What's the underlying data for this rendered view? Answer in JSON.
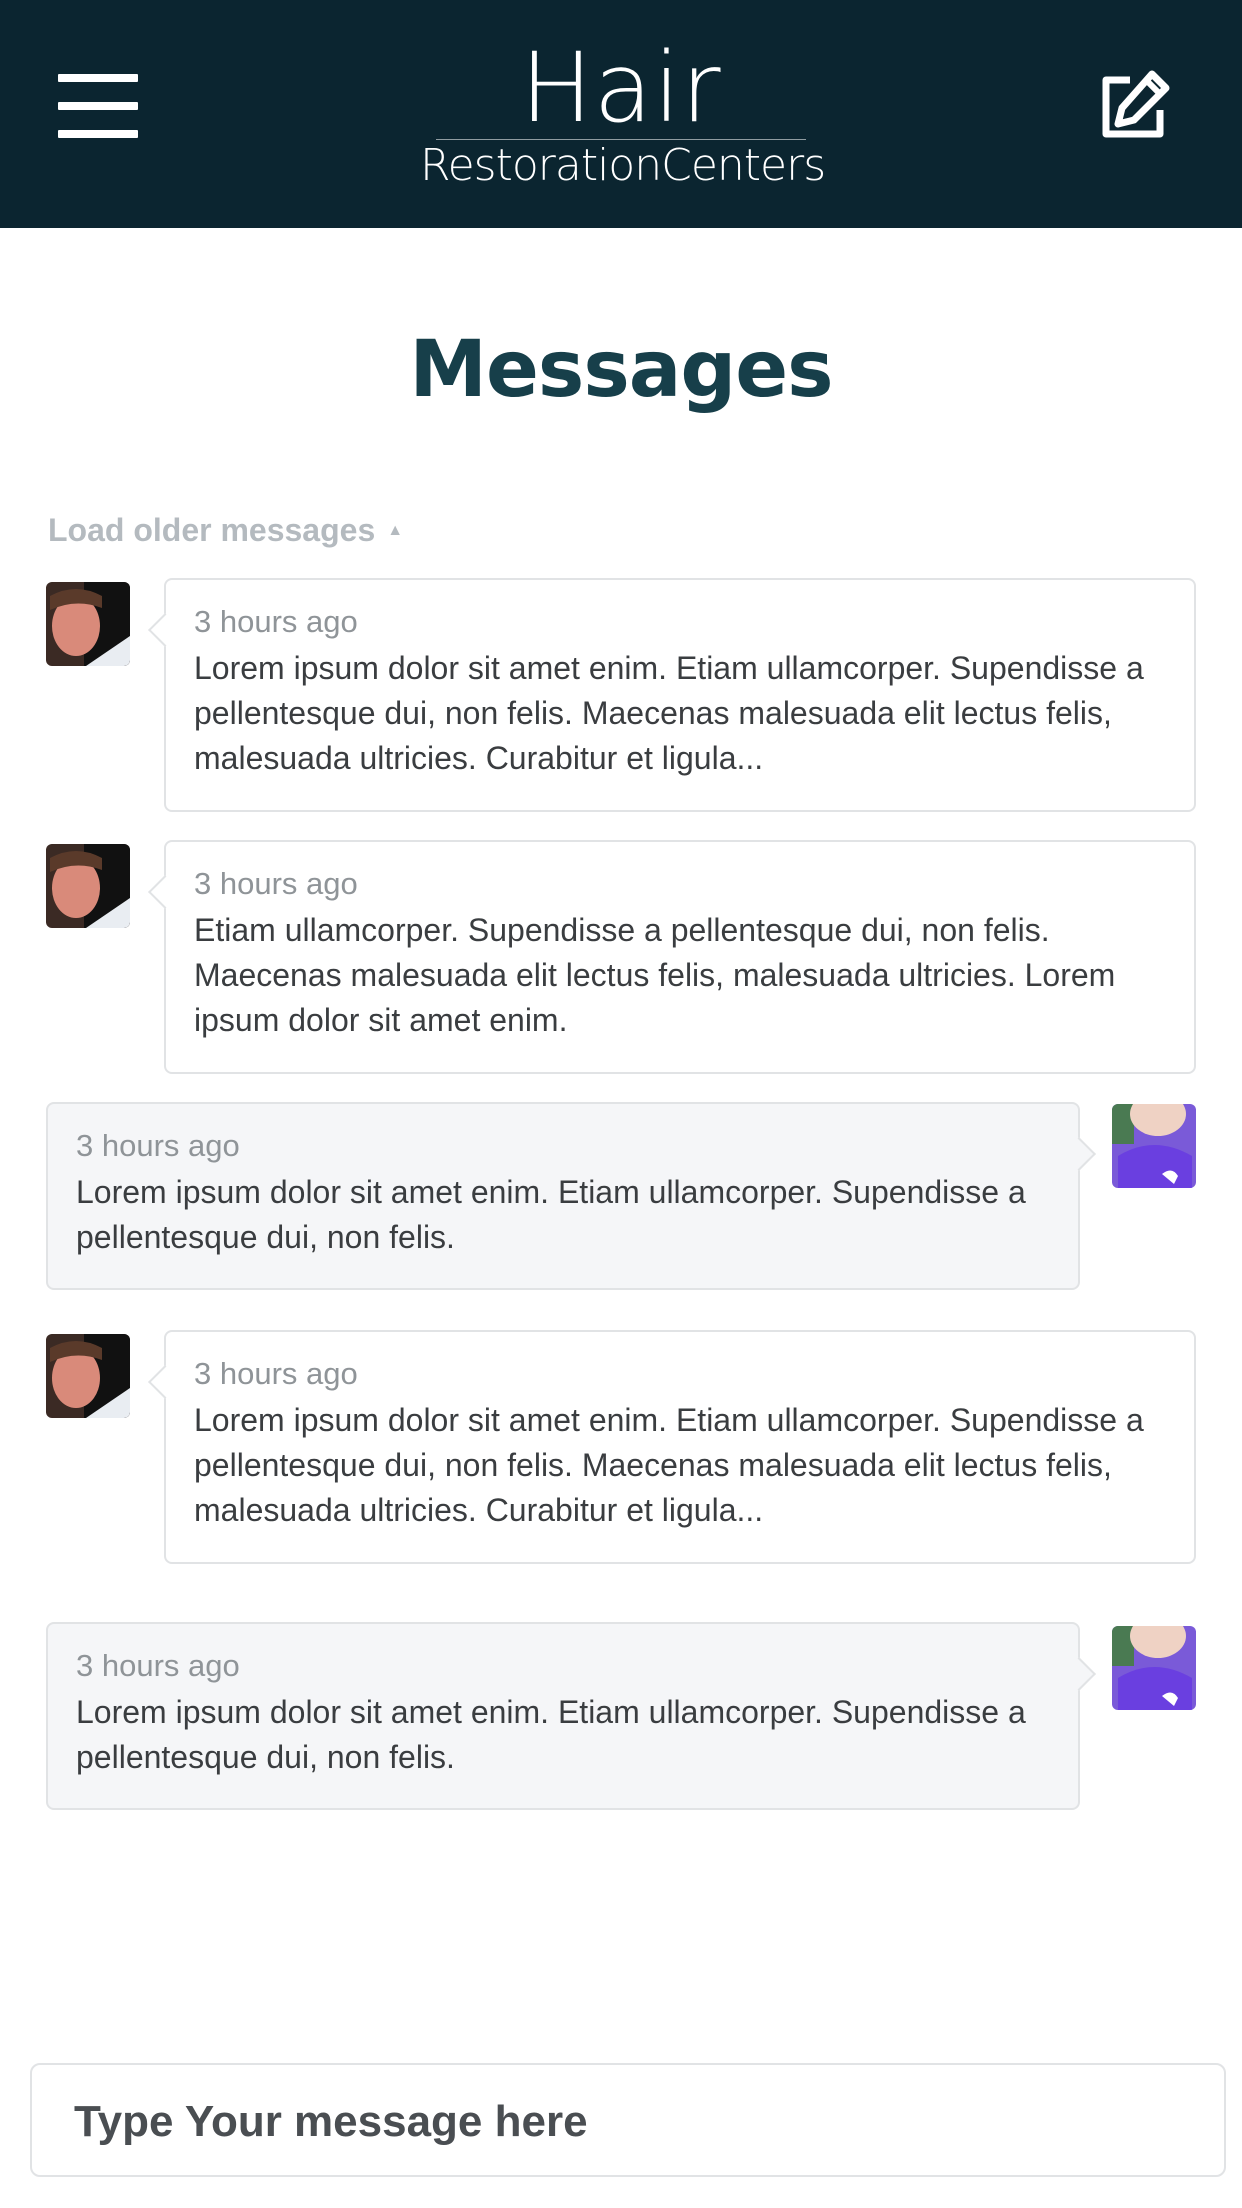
{
  "header": {
    "menu_icon": "hamburger-menu-icon",
    "compose_icon": "compose-edit-icon",
    "logo_main": "Hair",
    "logo_sub": "RestorationCenters",
    "background_color": "#0b2530"
  },
  "page": {
    "title": "Messages",
    "title_color": "#173f4a",
    "load_older_label": "Load older messages",
    "load_older_icon": "triangle-up-icon"
  },
  "messages": [
    {
      "direction": "incoming",
      "time": "3 hours ago",
      "text": "Lorem ipsum dolor sit amet enim. Etiam ullamcorper. Supendisse a pellentesque dui, non felis. Maecenas malesuada elit lectus felis, malesuada ultricies. Curabitur et ligula..."
    },
    {
      "direction": "incoming",
      "time": "3 hours ago",
      "text": "Etiam ullamcorper. Supendisse a pellentesque dui, non felis. Maecenas malesuada elit lectus felis, malesuada ultricies. Lorem ipsum dolor sit amet enim."
    },
    {
      "direction": "outgoing",
      "time": "3 hours ago",
      "text": "Lorem ipsum dolor sit amet enim. Etiam ullamcorper. Supendisse a pellentesque dui, non felis."
    },
    {
      "direction": "incoming",
      "time": "3 hours ago",
      "text": "Lorem ipsum dolor sit amet enim. Etiam ullamcorper. Supendisse a pellentesque dui, non felis. Maecenas malesuada elit lectus felis, malesuada ultricies. Curabitur et ligula..."
    },
    {
      "direction": "outgoing",
      "time": "3 hours ago",
      "text": "Lorem ipsum dolor sit amet enim. Etiam ullamcorper. Supendisse a pellentesque dui, non felis."
    }
  ],
  "composer": {
    "placeholder": "Type Your message here",
    "value": ""
  }
}
